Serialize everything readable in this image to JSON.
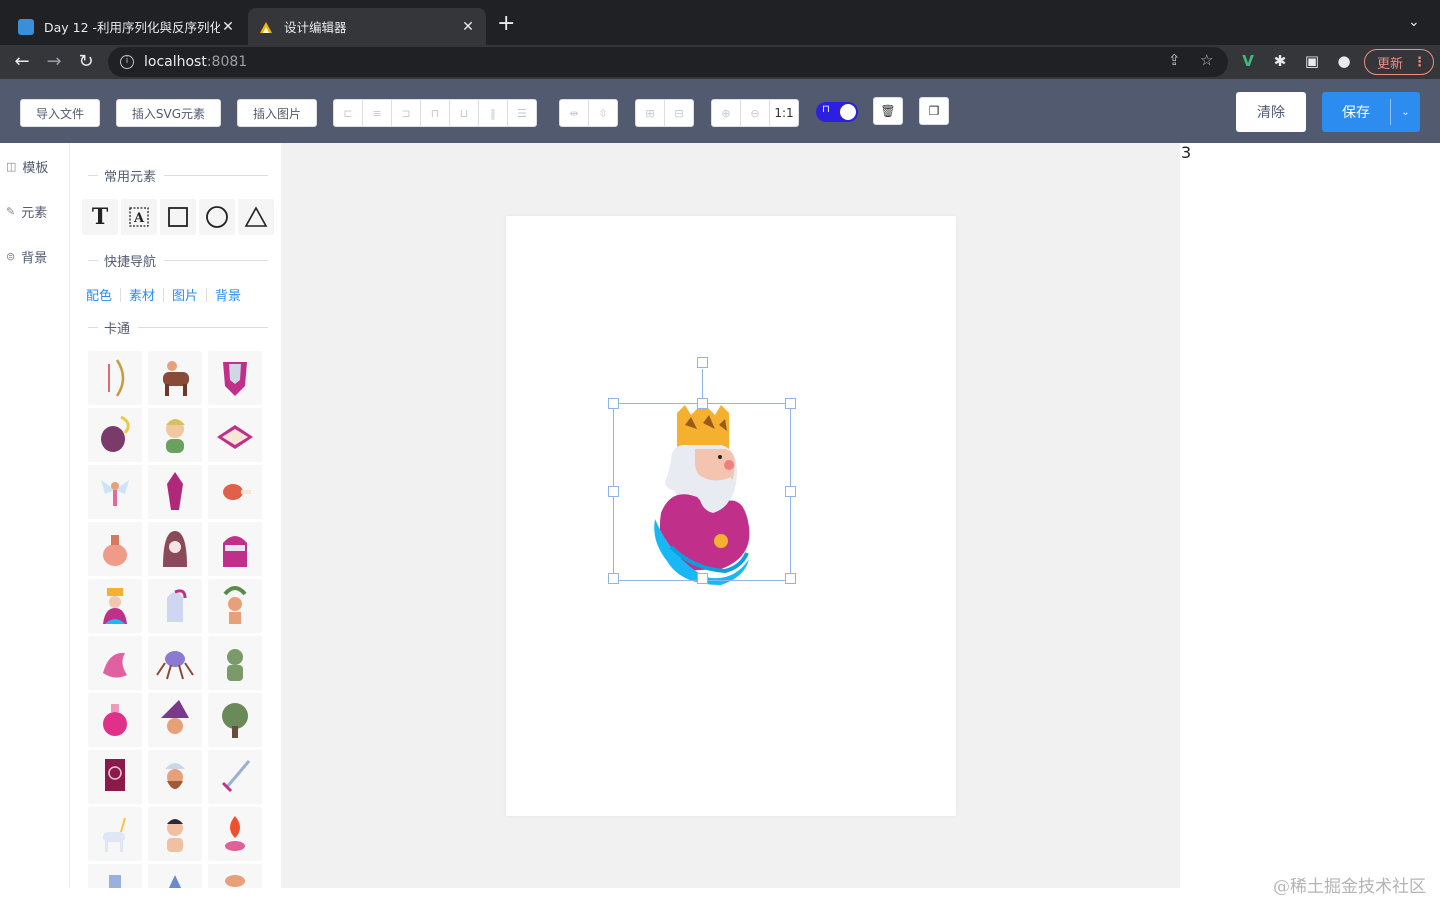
{
  "browser": {
    "tabs": [
      {
        "title": "Day 12 -利用序列化與反序列化"
      },
      {
        "title": "设计编辑器"
      }
    ],
    "address": {
      "host": "localhost",
      "port": ":8081"
    },
    "update_label": "更新"
  },
  "toolbar": {
    "import_file": "导入文件",
    "insert_svg": "插入SVG元素",
    "insert_image": "插入图片",
    "zoom_reset": "1:1"
  },
  "actions": {
    "clear": "清除",
    "save": "保存"
  },
  "rail": {
    "items": [
      {
        "label": "模板",
        "icon": "template-icon"
      },
      {
        "label": "元素",
        "icon": "pen-icon"
      },
      {
        "label": "背景",
        "icon": "background-icon"
      }
    ]
  },
  "panel": {
    "common_title": "常用元素",
    "quicknav_title": "快捷导航",
    "quicknav_links": [
      "配色",
      "素材",
      "图片",
      "背景"
    ],
    "cartoon_title": "卡通",
    "shapes": [
      "text-icon",
      "textbox-icon",
      "rectangle-icon",
      "circle-icon",
      "triangle-icon"
    ]
  },
  "canvas": {
    "layer_count": "3",
    "selected_element": "king-illustration"
  },
  "watermark": "@稀土掘金技术社区",
  "colors": {
    "accent": "#2d8cf0",
    "toolbar": "#515a6e",
    "toggle": "#2d1fe0",
    "update": "#f28b82"
  }
}
